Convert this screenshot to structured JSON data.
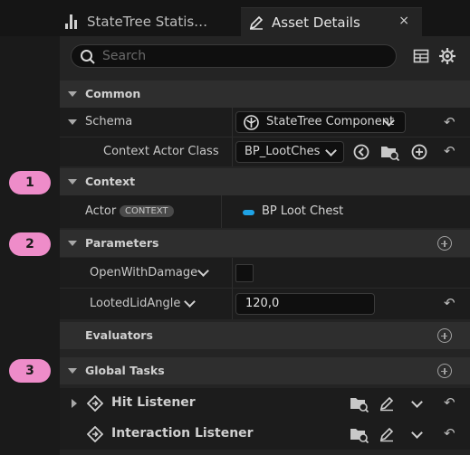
{
  "tabs": [
    {
      "label": "StateTree Statis…",
      "icon": "bar-chart-icon",
      "active": false
    },
    {
      "label": "Asset Details",
      "icon": "pencil-icon",
      "active": true
    }
  ],
  "tab_close": "×",
  "search": {
    "placeholder": "Search"
  },
  "toolbar": {
    "table_icon": "table-icon",
    "settings_icon": "gear-icon"
  },
  "categories": {
    "common": "Common",
    "context": "Context",
    "parameters": "Parameters",
    "evaluators": "Evaluators",
    "global_tasks": "Global Tasks"
  },
  "properties": {
    "schema": {
      "label": "Schema",
      "value": "StateTree Component"
    },
    "context_actor_class": {
      "label": "Context Actor Class",
      "value": "BP_LootChes"
    },
    "actor": {
      "label": "Actor",
      "tag": "CONTEXT",
      "value": "BP Loot Chest"
    },
    "open_with_damage": {
      "label": "OpenWithDamage",
      "checked": false
    },
    "looted_lid_angle": {
      "label": "LootedLidAngle",
      "value": "120,0"
    }
  },
  "tasks": [
    {
      "label": "Hit Listener",
      "expandable": true
    },
    {
      "label": "Interaction Listener",
      "expandable": false
    }
  ],
  "annotations": [
    "1",
    "2",
    "3"
  ],
  "colors": {
    "badge": "#ee8cc9",
    "actor_pill": "#1fa3e6"
  }
}
